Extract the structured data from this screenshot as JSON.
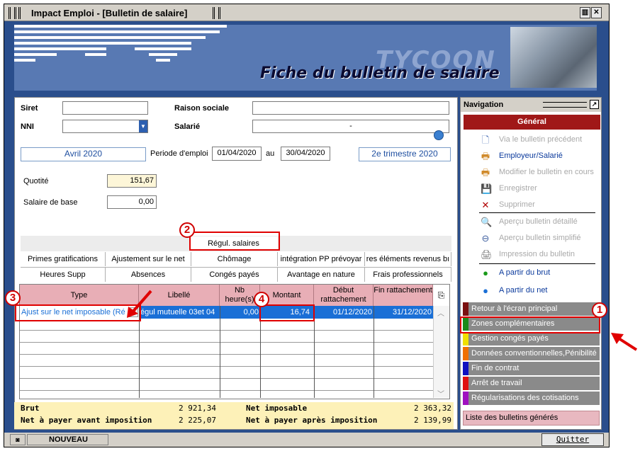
{
  "window": {
    "title": "Impact Emploi - [Bulletin de salaire]"
  },
  "banner": {
    "logo_text": "TYCOON",
    "heading": "Fiche du bulletin de salaire"
  },
  "form": {
    "siret_label": "Siret",
    "raison_label": "Raison sociale",
    "nni_label": "NNI",
    "salarie_label": "Salarié",
    "salarie_value": "-",
    "period_month": "Avril 2020",
    "periode_label": "Periode d'emploi",
    "period_start": "01/04/2020",
    "au_label": "au",
    "period_end": "30/04/2020",
    "trimestre": "2e trimestre 2020",
    "quotite_label": "Quotité",
    "quotite_value": "151,67",
    "salaire_base_label": "Salaire de base",
    "salaire_base_value": "0,00"
  },
  "tabs": {
    "top": "Régul. salaires",
    "row1": [
      "Primes gratifications",
      "Ajustement sur le net",
      "Chômage",
      "intégration PP prévoyar",
      "res éléments revenus bı"
    ],
    "row2": [
      "Heures Supp",
      "Absences",
      "Congés payés",
      "Avantage en nature",
      "Frais professionnels"
    ]
  },
  "grid": {
    "headers": [
      "Type",
      "Libellé",
      "Nb heure(s)",
      "Montant",
      "Début rattachement",
      "Fin rattachement"
    ],
    "rows": [
      {
        "type": "Ajust sur le net imposable (Ré",
        "libelle": "égul mutuelle 03et 04",
        "nb": "0,00",
        "montant": "16,74",
        "debut": "01/12/2020",
        "fin": "31/12/2020"
      }
    ]
  },
  "totals": {
    "brut_label": "Brut",
    "brut_value": "2 921,34",
    "net_imposable_label": "Net imposable",
    "net_imposable_value": "2 363,32",
    "net_avant_label": "Net à payer avant imposition",
    "net_avant_value": "2 225,07",
    "net_apres_label": "Net à payer après imposition",
    "net_apres_value": "2 139,99"
  },
  "nav": {
    "title": "Navigation",
    "section": "Général",
    "items": [
      {
        "label": "Via le bulletin précédent",
        "icon": "copy-icon",
        "active": false
      },
      {
        "label": "Employeur/Salarié",
        "icon": "printer-icon",
        "active": true
      },
      {
        "label": "Modifier le bulletin en cours",
        "icon": "printer-icon",
        "active": false
      },
      {
        "label": "Enregistrer",
        "icon": "save-icon",
        "active": false
      },
      {
        "label": "Supprimer",
        "icon": "delete-icon",
        "active": false
      },
      {
        "label": "Aperçu bulletin détaillé",
        "icon": "preview-icon",
        "active": false
      },
      {
        "label": "Aperçu bulletin simplifié",
        "icon": "zoom-icon",
        "active": false
      },
      {
        "label": "Impression du bulletin",
        "icon": "print-icon",
        "active": false
      },
      {
        "label": "A partir du brut",
        "icon": "green-circle-icon",
        "active": true
      },
      {
        "label": "A partir du net",
        "icon": "blue-circle-icon",
        "active": true
      }
    ],
    "buttons": [
      {
        "label": "Retour à l'écran principal",
        "color": "#7a1010"
      },
      {
        "label": "Zones complémentaires",
        "color": "#1a8a1a"
      },
      {
        "label": "Gestion congés payés",
        "color": "#f0e000"
      },
      {
        "label": "Données conventionnelles,Pénibilité",
        "color": "#f07000"
      },
      {
        "label": "Fin de contrat",
        "color": "#1010c0"
      },
      {
        "label": "Arrêt de travail",
        "color": "#e01010"
      },
      {
        "label": "Régularisations des cotisations",
        "color": "#a010c0"
      }
    ],
    "list_button": "Liste des bulletins générés"
  },
  "status": {
    "mode": "NOUVEAU",
    "quit": "Quitter"
  },
  "annotations": [
    "1",
    "2",
    "3",
    "4"
  ]
}
